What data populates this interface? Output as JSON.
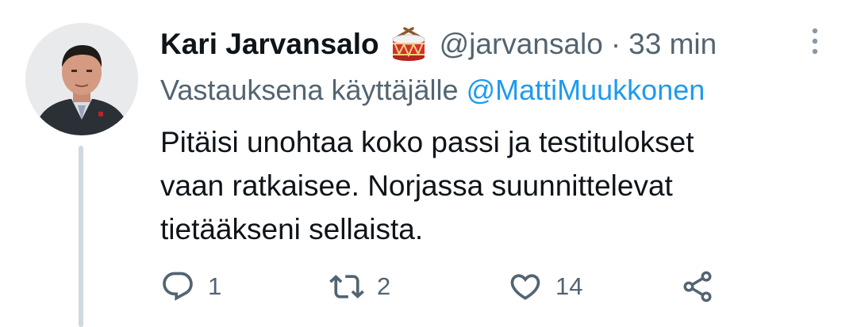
{
  "tweet": {
    "author": {
      "display_name": "Kari Jarvansalo",
      "emoji": "drum-emoji",
      "handle": "@jarvansalo"
    },
    "separator": "·",
    "timestamp": "33 min",
    "reply_context": {
      "prefix": "Vastauksena käyttäjälle",
      "mention": "@MattiMuukkonen"
    },
    "text_lines": [
      "Pitäisi unohtaa koko passi ja testitulokset",
      "vaan ratkaisee. Norjassa suunnittelevat",
      "tietääkseni sellaista."
    ],
    "actions": {
      "reply": {
        "icon": "reply-icon",
        "count": "1"
      },
      "retweet": {
        "icon": "retweet-icon",
        "count": "2"
      },
      "like": {
        "icon": "heart-icon",
        "count": "14"
      },
      "share": {
        "icon": "share-icon"
      }
    }
  },
  "colors": {
    "text_primary": "#0f1419",
    "text_secondary": "#536471",
    "accent": "#1d9bf0",
    "thread_line": "#cfd9de"
  }
}
